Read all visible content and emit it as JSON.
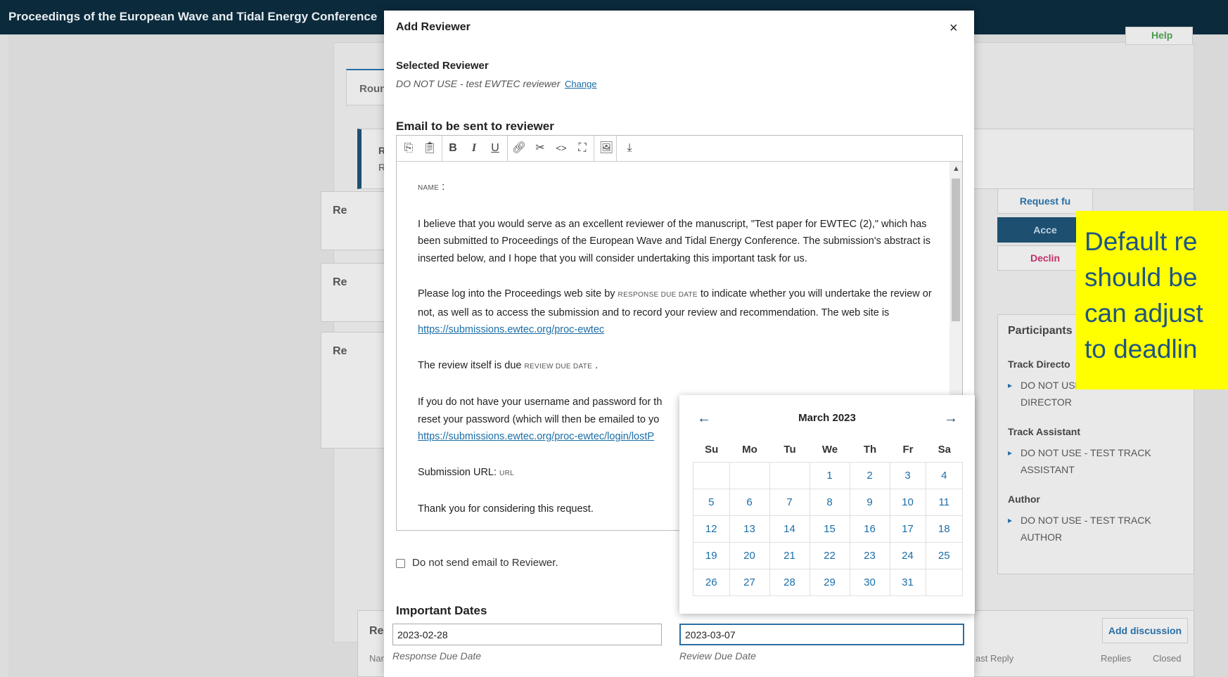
{
  "header": {
    "site_title": "Proceedings of the European Wave and Tidal Energy Conference"
  },
  "background": {
    "help_label": "Help",
    "round_tab": "Roun",
    "notice_line1": "R",
    "notice_line2": "R",
    "section_heads": [
      "Re",
      "Re",
      "Re",
      "Re"
    ],
    "buttons": {
      "request": "Request fu",
      "accept": "Acce",
      "decline": "Declin"
    },
    "participants": {
      "title": "Participants",
      "groups": [
        {
          "label": "Track Directo",
          "member": "DO NOT USE - TEST TRACK DIRECTOR"
        },
        {
          "label": "Track Assistant",
          "member": "DO NOT USE - TEST TRACK ASSISTANT"
        },
        {
          "label": "Author",
          "member": "DO NOT USE - TEST TRACK AUTHOR"
        }
      ]
    },
    "discussion": {
      "add_label": "Add discussion",
      "col_name": "Nar",
      "col_last_reply": "ast Reply",
      "col_replies": "Replies",
      "col_closed": "Closed"
    }
  },
  "modal": {
    "title": "Add Reviewer",
    "close_symbol": "×",
    "selected_label": "Selected Reviewer",
    "selected_name": "DO NOT USE - test EWTEC reviewer",
    "change_label": "Change",
    "email_label": "Email to be sent to reviewer",
    "toolbar_icons": [
      "copy-icon",
      "paste-icon",
      "bold-icon",
      "italic-icon",
      "underline-icon",
      "link-icon",
      "unlink-icon",
      "code-icon",
      "fullscreen-icon",
      "image-icon",
      "upload-icon"
    ],
    "email": {
      "var_name": "NAME",
      "p1": "I believe that you would serve as an excellent reviewer of the manuscript, \"Test paper for EWTEC (2),\" which has been submitted to Proceedings of the European Wave and Tidal Energy Conference. The submission's abstract is inserted below, and I hope that you will consider undertaking this important task for us.",
      "p2_a": "Please log into the Proceedings web site by",
      "var_response_due": "RESPONSE DUE DATE",
      "p2_b": "to indicate whether you will undertake the review or not, as well as to access the submission and to record your review and recommendation. The web site is",
      "site_url": "https://submissions.ewtec.org/proc-ewtec",
      "p3_a": "The review itself is due",
      "var_review_due": "REVIEW DUE DATE",
      "p4_a": "If you do not have your username and password for th",
      "p4_b": "reset your password (which will then be emailed to yo",
      "lost_url": "https://submissions.ewtec.org/proc-ewtec/login/lostP",
      "p5_a": "Submission URL:",
      "var_url": "URL",
      "p6": "Thank you for considering this request."
    },
    "no_email_label": "Do not send email to Reviewer.",
    "dates_label": "Important Dates",
    "response_due_value": "2023-02-28",
    "response_due_hint": "Response Due Date",
    "review_due_value": "2023-03-07",
    "review_due_hint": "Review Due Date"
  },
  "calendar": {
    "month_label": "March 2023",
    "weekdays": [
      "Su",
      "Mo",
      "Tu",
      "We",
      "Th",
      "Fr",
      "Sa"
    ],
    "leading_blanks": 3,
    "days_in_month": 31
  },
  "annotation": {
    "text": "Default re\nshould be\ncan adjust\nto deadlin"
  },
  "colors": {
    "header_bg": "#0b2a3b",
    "link": "#1b6ea8",
    "annotation_bg": "#ffff00",
    "annotation_text": "#1f5582"
  }
}
